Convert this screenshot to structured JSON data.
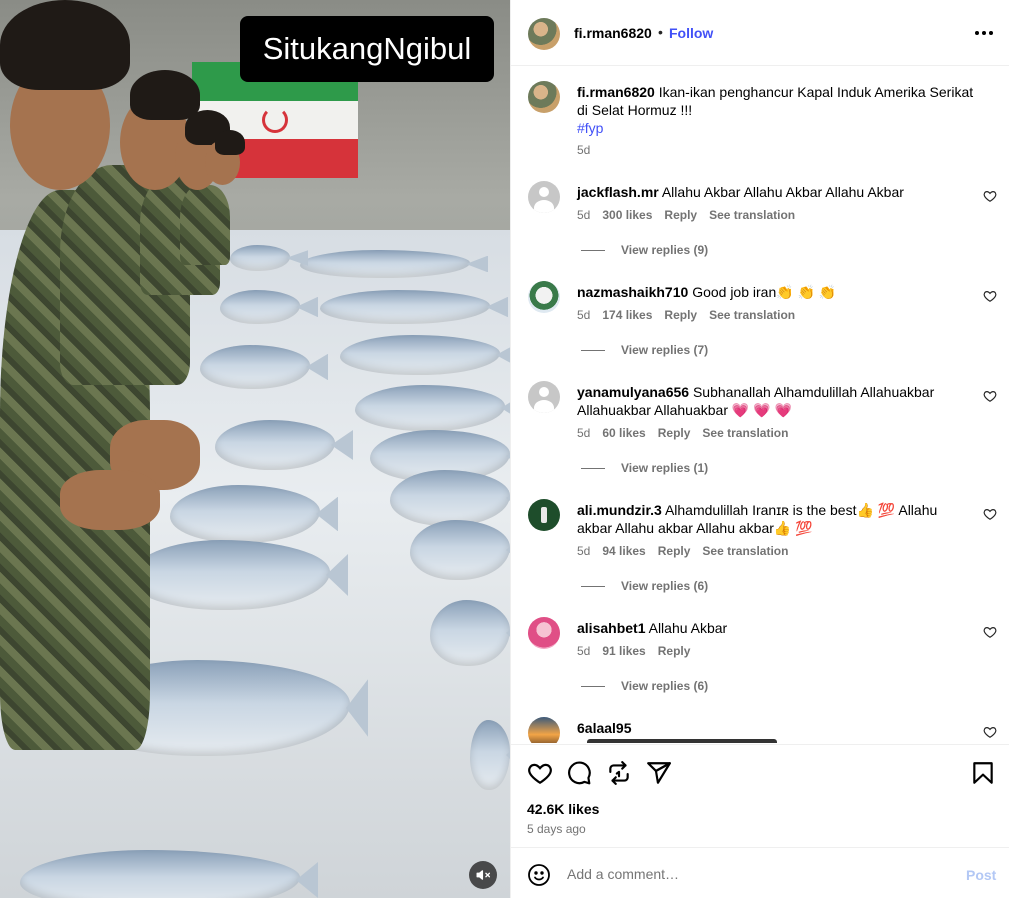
{
  "media": {
    "watermark": "SitukangNgibul",
    "mute_icon": "mute-speaker-icon"
  },
  "post": {
    "username": "fi.rman6820",
    "dot": "•",
    "follow_label": "Follow",
    "more_icon": "more-options-icon",
    "caption_user": "fi.rman6820",
    "caption_text": "Ikan-ikan penghancur Kapal Induk Amerika Serikat di Selat Hormuz !!!",
    "caption_tag": "#fyp",
    "caption_age": "5d"
  },
  "comments": [
    {
      "user": "jackflash.mr",
      "text": "Allahu Akbar Allahu Akbar Allahu Akbar",
      "age": "5d",
      "likes": "300 likes",
      "reply": "Reply",
      "translate": "See translation",
      "replies": "View replies (9)"
    },
    {
      "user": "nazmashaikh710",
      "text": "Good job iran👏 👏 👏",
      "age": "5d",
      "likes": "174 likes",
      "reply": "Reply",
      "translate": "See translation",
      "replies": "View replies (7)"
    },
    {
      "user": "yanamulyana656",
      "text": "Subhanallah Alhamdulillah Allahuakbar Allahuakbar Allahuakbar 💗 💗 💗",
      "age": "5d",
      "likes": "60 likes",
      "reply": "Reply",
      "translate": "See translation",
      "replies": "View replies (1)"
    },
    {
      "user": "ali.mundzir.3",
      "text": "Alhamdulillah Iranɪʀ is the best👍 💯 Allahu akbar Allahu akbar Allahu akbar👍 💯",
      "age": "5d",
      "likes": "94 likes",
      "reply": "Reply",
      "translate": "See translation",
      "replies": "View replies (6)"
    },
    {
      "user": "alisahbet1",
      "text": "Allahu Akbar",
      "age": "5d",
      "likes": "91 likes",
      "reply": "Reply",
      "translate": "",
      "replies": "View replies (6)"
    },
    {
      "user": "6alaal95",
      "text": "",
      "age": "",
      "likes": "",
      "reply": "",
      "translate": "",
      "replies": ""
    }
  ],
  "actions": {
    "like_icon": "heart-icon",
    "comment_icon": "comment-icon",
    "repost_icon": "repost-icon",
    "share_icon": "share-icon",
    "save_icon": "bookmark-icon",
    "likes_count": "42.6K likes",
    "posted_ago": "5 days ago"
  },
  "add_comment": {
    "emoji_icon": "emoji-icon",
    "placeholder": "Add a comment…",
    "post_label": "Post"
  }
}
